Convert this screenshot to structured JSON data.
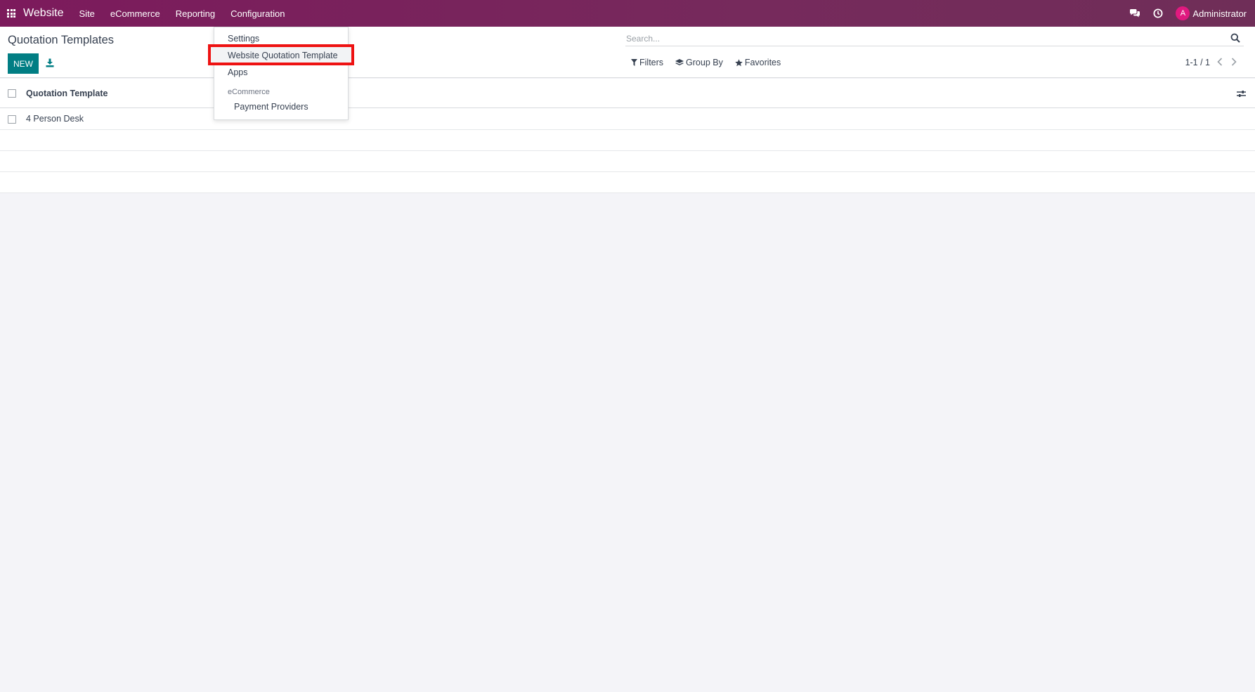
{
  "navbar": {
    "brand": "Website",
    "menus": [
      "Site",
      "eCommerce",
      "Reporting",
      "Configuration"
    ],
    "user_initial": "A",
    "user_name": "Administrator",
    "background": "#7c1a5c"
  },
  "control_panel": {
    "title": "Quotation Templates",
    "new_label": "NEW",
    "search_placeholder": "Search...",
    "filters_label": "Filters",
    "group_by_label": "Group By",
    "favorites_label": "Favorites",
    "pager": "1-1 / 1",
    "accent": "#017e84"
  },
  "list": {
    "header": "Quotation Template",
    "rows": [
      "4 Person Desk"
    ]
  },
  "config_dropdown": {
    "items": [
      "Settings",
      "Website Quotation Template",
      "Apps"
    ],
    "section_header": "eCommerce",
    "section_items": [
      "Payment Providers"
    ],
    "highlight_color": "#ee1212"
  }
}
